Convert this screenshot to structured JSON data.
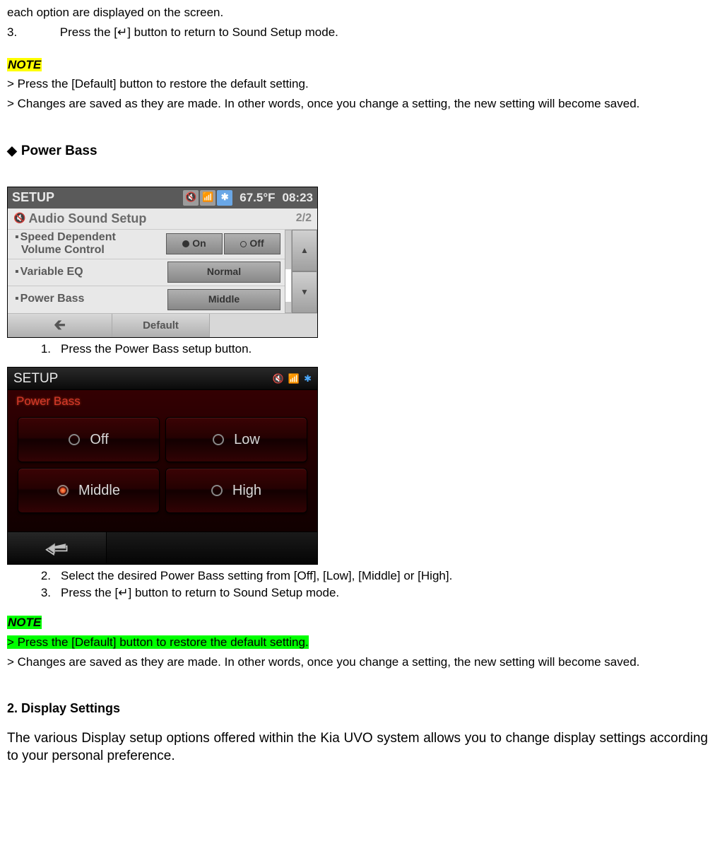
{
  "top": {
    "line0": "each option are displayed on the screen.",
    "step3_num": "3.",
    "step3_text": "Press the [↵] button to return to Sound Setup mode."
  },
  "note1": {
    "title": "NOTE",
    "l1": "> Press the [Default] button to restore the default setting.",
    "l2": "> Changes are saved as they are made. In other words, once you change a setting, the new setting will become saved."
  },
  "section_powerbass": "Power Bass",
  "shot1": {
    "header_title": "SETUP",
    "temp": "67.5°F",
    "time": "08:23",
    "sub_title": "Audio Sound Setup",
    "page": "2/2",
    "row1_label_a": "Speed Dependent",
    "row1_label_b": "Volume Control",
    "r1_on": "On",
    "r1_off": "Off",
    "row2_label": "Variable EQ",
    "row2_val": "Normal",
    "row3_label": "Power Bass",
    "row3_val": "Middle",
    "default_btn": "Default"
  },
  "caption1_num": "1.",
  "caption1_text": "Press the Power Bass setup button.",
  "shot2": {
    "header_title": "SETUP",
    "sub_title": "Power Bass",
    "opt_off": "Off",
    "opt_low": "Low",
    "opt_middle": "Middle",
    "opt_high": "High"
  },
  "caption2_num": "2.",
  "caption2_text": "Select the desired Power Bass setting from [Off], [Low], [Middle] or [High].",
  "caption3_num": "3.",
  "caption3_text": "Press the [↵] button to return to Sound Setup mode.",
  "note2": {
    "title": "NOTE",
    "l1": "> Press the [Default] button to restore the default setting.",
    "l2": "> Changes are saved as they are made. In other words, once you change a setting, the new setting will become saved."
  },
  "h_display": "2. Display Settings",
  "display_body": "The various Display setup options offered within the Kia UVO system allows you to change display settings according to your personal preference."
}
